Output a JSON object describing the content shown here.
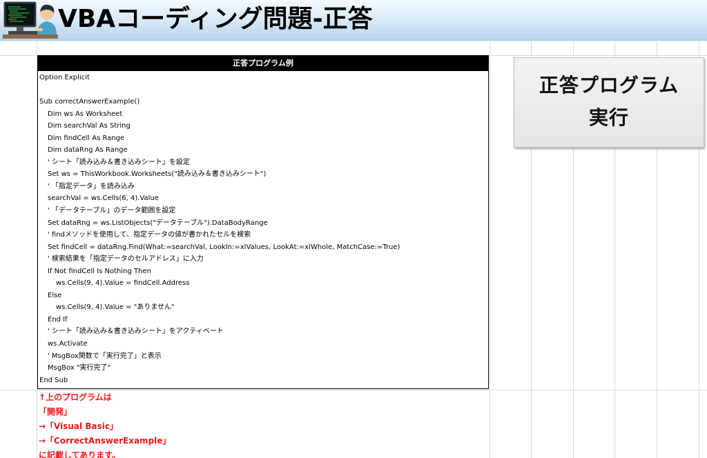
{
  "header": {
    "title": "VBAコーディング問題-正答",
    "illustration_icon": "programmer-at-computer-icon"
  },
  "code_block": {
    "header": "正答プログラム例",
    "lines": [
      {
        "text": "Option Explicit",
        "indent": 0
      },
      {
        "text": "",
        "indent": 0
      },
      {
        "text": "Sub correctAnswerExample()",
        "indent": 0
      },
      {
        "text": "Dim ws As Worksheet",
        "indent": 1
      },
      {
        "text": "Dim searchVal As String",
        "indent": 1
      },
      {
        "text": "Dim findCell As Range",
        "indent": 1
      },
      {
        "text": "Dim dataRng As Range",
        "indent": 1
      },
      {
        "text": "' シート「読み込み＆書き込みシート」を設定",
        "indent": 1
      },
      {
        "text": "Set ws = ThisWorkbook.Worksheets(\"読み込み＆書き込みシート\")",
        "indent": 1
      },
      {
        "text": "' 「指定データ」を読み込み",
        "indent": 1
      },
      {
        "text": "searchVal = ws.Cells(6, 4).Value",
        "indent": 1
      },
      {
        "text": "' 「データテーブル」のデータ範囲を設定",
        "indent": 1
      },
      {
        "text": "Set dataRng = ws.ListObjects(\"データテーブル\").DataBodyRange",
        "indent": 1
      },
      {
        "text": "' findメソッドを使用して、指定データの値が書かれたセルを検索",
        "indent": 1
      },
      {
        "text": "Set findCell = dataRng.Find(What:=searchVal, LookIn:=xlValues, LookAt:=xlWhole, MatchCase:=True)",
        "indent": 1
      },
      {
        "text": "' 検索結果を「指定データのセルアドレス」に入力",
        "indent": 1
      },
      {
        "text": "If Not findCell Is Nothing Then",
        "indent": 1
      },
      {
        "text": "ws.Cells(9, 4).Value = findCell.Address",
        "indent": 2
      },
      {
        "text": "Else",
        "indent": 1
      },
      {
        "text": "ws.Cells(9, 4).Value = \"ありません\"",
        "indent": 2
      },
      {
        "text": "End If",
        "indent": 1
      },
      {
        "text": "' シート「読み込み＆書き込みシート」をアクティベート",
        "indent": 1
      },
      {
        "text": "ws.Activate",
        "indent": 1
      },
      {
        "text": "' MsgBox関数で「実行完了」と表示",
        "indent": 1
      },
      {
        "text": "MsgBox \"実行完了\"",
        "indent": 1
      },
      {
        "text": "End Sub",
        "indent": 0
      }
    ]
  },
  "run_button": {
    "line1": "正答プログラム",
    "line2": "実行"
  },
  "note": {
    "lines": [
      "↑上のプログラムは",
      "「開発」",
      "→「Visual Basic」",
      "→「CorrectAnswerExample」",
      "に記載してあります。"
    ]
  },
  "colors": {
    "note_text": "#e8191a",
    "code_header_bg": "#000000",
    "header_gradient_bottom": "#b8d4ec"
  }
}
